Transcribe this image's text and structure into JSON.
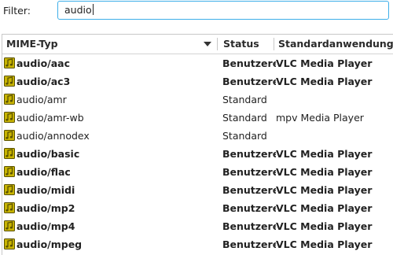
{
  "filter": {
    "label": "Filter:",
    "value": "audio"
  },
  "table": {
    "columns": [
      "MIME-Typ",
      "Status",
      "Standardanwendung"
    ],
    "sort_indicator": "sort-descending-icon",
    "rows": [
      {
        "mime": "audio/aac",
        "status": "Benutzere",
        "app": "VLC Media Player",
        "bold": true
      },
      {
        "mime": "audio/ac3",
        "status": "Benutzere",
        "app": "VLC Media Player",
        "bold": true
      },
      {
        "mime": "audio/amr",
        "status": "Standard",
        "app": "",
        "bold": false
      },
      {
        "mime": "audio/amr-wb",
        "status": "Standard",
        "app": "mpv Media Player",
        "bold": false
      },
      {
        "mime": "audio/annodex",
        "status": "Standard",
        "app": "",
        "bold": false
      },
      {
        "mime": "audio/basic",
        "status": "Benutzere",
        "app": "VLC Media Player",
        "bold": true
      },
      {
        "mime": "audio/flac",
        "status": "Benutzere",
        "app": "VLC Media Player",
        "bold": true
      },
      {
        "mime": "audio/midi",
        "status": "Benutzere",
        "app": "VLC Media Player",
        "bold": true
      },
      {
        "mime": "audio/mp2",
        "status": "Benutzere",
        "app": "VLC Media Player",
        "bold": true
      },
      {
        "mime": "audio/mp4",
        "status": "Benutzere",
        "app": "VLC Media Player",
        "bold": true
      },
      {
        "mime": "audio/mpeg",
        "status": "Benutzere",
        "app": "VLC Media Player",
        "bold": true
      }
    ]
  },
  "colors": {
    "accent": "#3daee9",
    "icon_fill": "#c8b400",
    "icon_stroke": "#5a5200"
  }
}
